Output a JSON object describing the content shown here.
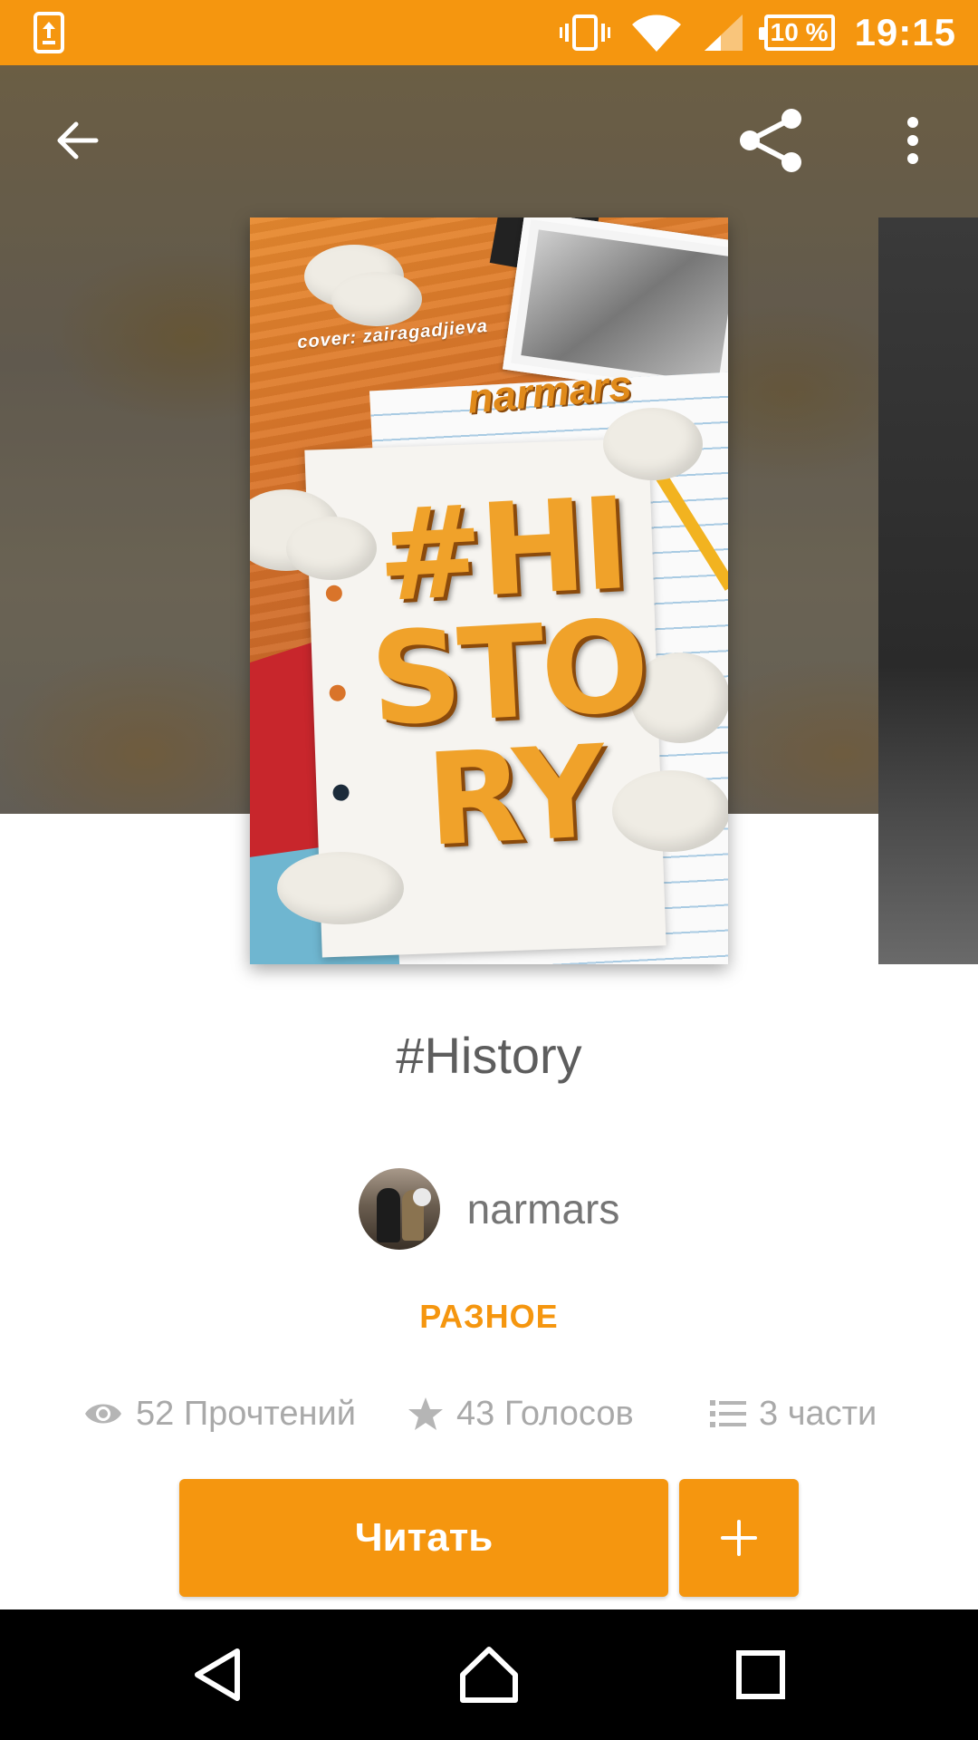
{
  "status_bar": {
    "battery": "10 %",
    "time": "19:15",
    "background_color": "#f5960f"
  },
  "toolbar": {
    "back_icon": "arrow-left-icon",
    "share_icon": "share-icon",
    "more_icon": "more-vert-icon"
  },
  "cover": {
    "credit": "cover: zairagadjieva",
    "author": "narmars",
    "title_lines": [
      "#HI",
      "STO",
      "RY"
    ]
  },
  "book": {
    "title": "#History",
    "author": "narmars",
    "category": "РАЗНОЕ",
    "accent_color": "#f5960f"
  },
  "stats": {
    "reads": "52 Прочтений",
    "votes": "43 Голосов",
    "parts": "3 части"
  },
  "actions": {
    "read_label": "Читать",
    "add_label": "+"
  },
  "nav_bar": {
    "back": "nav-back-icon",
    "home": "nav-home-icon",
    "recents": "nav-recents-icon"
  }
}
